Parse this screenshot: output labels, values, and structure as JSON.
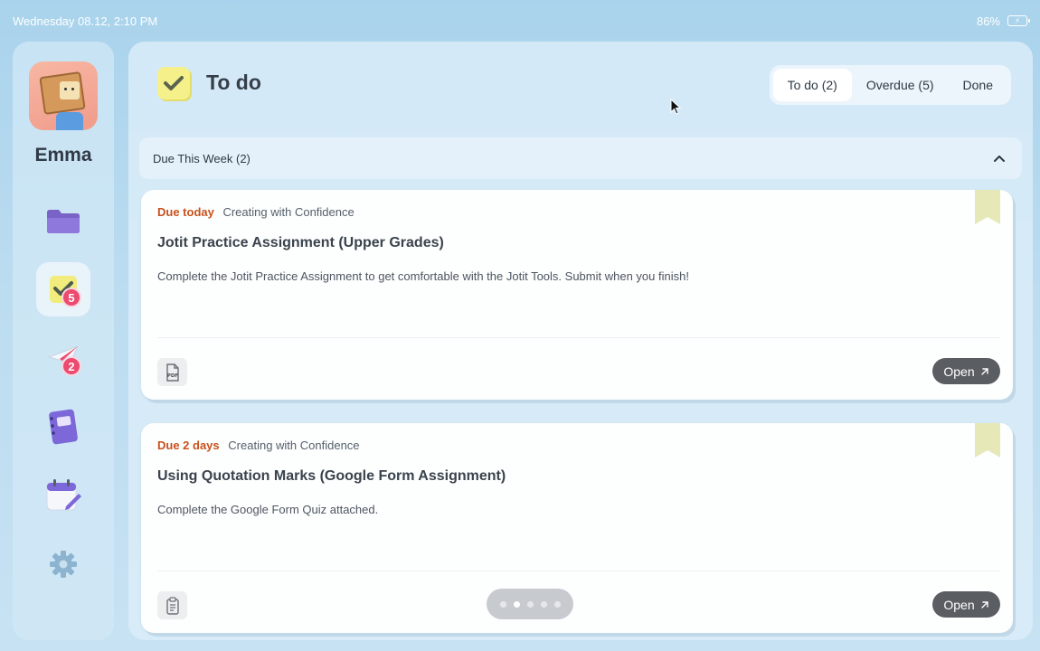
{
  "status_bar": {
    "datetime": "Wednesday 08.12, 2:10 PM",
    "battery_percent": "86%",
    "battery_icon": "battery-charging-icon"
  },
  "sidebar": {
    "username": "Emma",
    "items": [
      {
        "name": "folder",
        "icon": "folder-icon",
        "active": false
      },
      {
        "name": "todo",
        "icon": "checkmark-note-icon",
        "badge": "5",
        "active": true
      },
      {
        "name": "messages",
        "icon": "paper-plane-icon",
        "badge": "2",
        "active": false
      },
      {
        "name": "notebook",
        "icon": "notebook-icon",
        "active": false
      },
      {
        "name": "calendar",
        "icon": "calendar-edit-icon",
        "active": false
      },
      {
        "name": "settings",
        "icon": "gear-icon",
        "active": false
      }
    ]
  },
  "header": {
    "title": "To do",
    "icon": "checkmark-note-icon",
    "tabs": [
      {
        "label": "To do (2)",
        "active": true
      },
      {
        "label": "Overdue (5)",
        "active": false
      },
      {
        "label": "Done",
        "active": false
      }
    ]
  },
  "section": {
    "title": "Due This Week (2)",
    "collapse_icon": "chevron-up-icon"
  },
  "assignments": [
    {
      "due": "Due today",
      "course": "Creating with Confidence",
      "title": "Jotit Practice Assignment (Upper Grades)",
      "description": "Complete the Jotit Practice Assignment to get comfortable with the Jotit Tools. Submit when you finish!",
      "attachment_icon": "pdf-file-icon",
      "attachment_label": "PDF",
      "open_label": "Open"
    },
    {
      "due": "Due 2 days",
      "course": "Creating with Confidence",
      "title": "Using Quotation Marks (Google Form Assignment)",
      "description": "Complete the Google Form Quiz attached.",
      "attachment_icon": "clipboard-icon",
      "open_label": "Open"
    }
  ],
  "pager": {
    "pages": 5,
    "current_page": 2
  },
  "colors": {
    "accent_due": "#c8511c",
    "badge": "#ec4a6e",
    "open_button": "#5a5e63",
    "bookmark": "#e6e9b7",
    "note_yellow": "#f5f08a"
  }
}
